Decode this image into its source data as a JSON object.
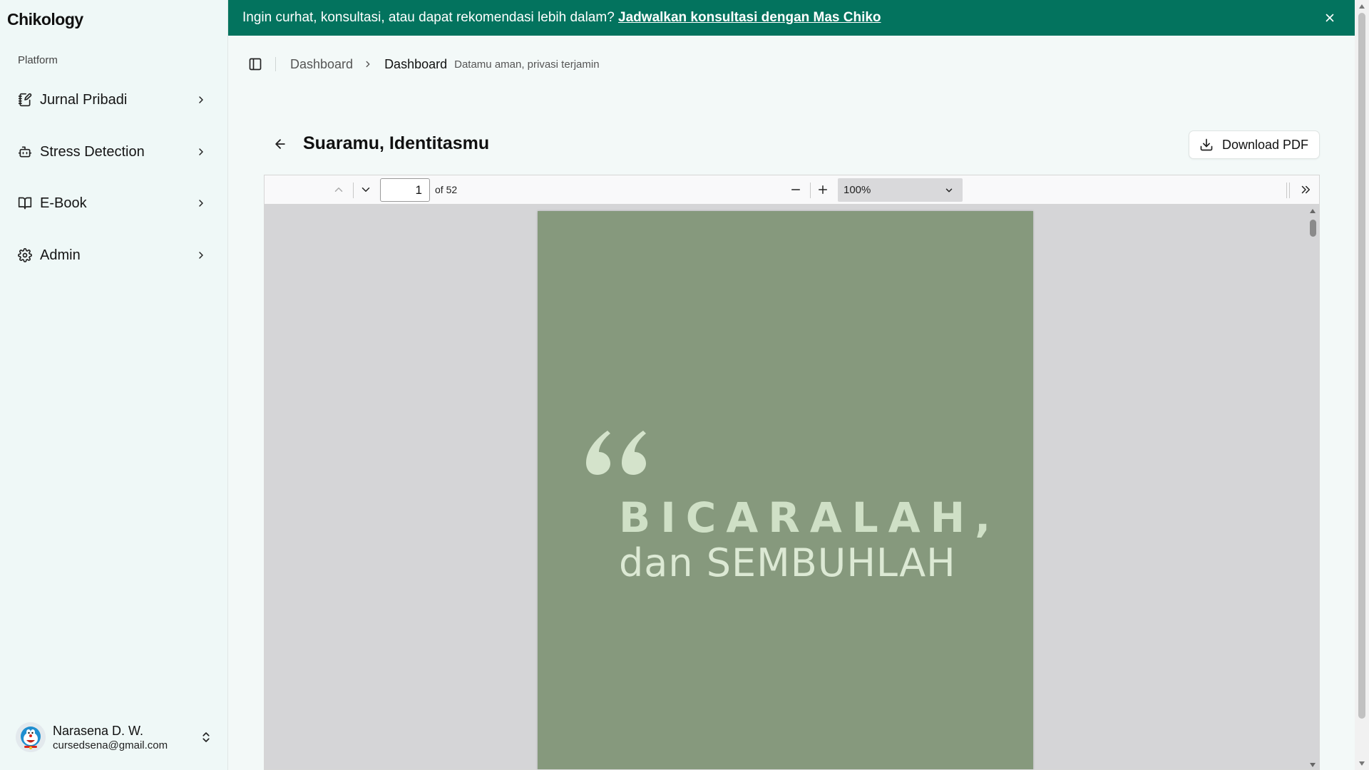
{
  "app": {
    "brand": "Chikology"
  },
  "sidebar": {
    "group_label": "Platform",
    "items": [
      {
        "label": "Jurnal Pribadi",
        "icon": "journal-edit-icon"
      },
      {
        "label": "Stress Detection",
        "icon": "bot-icon"
      },
      {
        "label": "E-Book",
        "icon": "book-open-icon"
      },
      {
        "label": "Admin",
        "icon": "gear-icon"
      }
    ],
    "user": {
      "name": "Narasena D. W.",
      "email": "cursedsena@gmail.com"
    }
  },
  "banner": {
    "text": "Ingin curhat, konsultasi, atau dapat rekomendasi lebih dalam? ",
    "link": "Jadwalkan konsultasi dengan Mas Chiko",
    "background": "#03735e"
  },
  "header": {
    "crumb": "Dashboard",
    "current": "Dashboard",
    "note": "Datamu aman, privasi terjamin"
  },
  "content": {
    "title": "Suaramu, Identitasmu",
    "download_label": "Download PDF"
  },
  "pdf": {
    "page_number": "1",
    "page_total": "of 52",
    "zoom": "100%",
    "cover": {
      "line1": "BICARALAH,",
      "line2": "dan SEMBUHLAH",
      "background": "#86997d"
    }
  }
}
